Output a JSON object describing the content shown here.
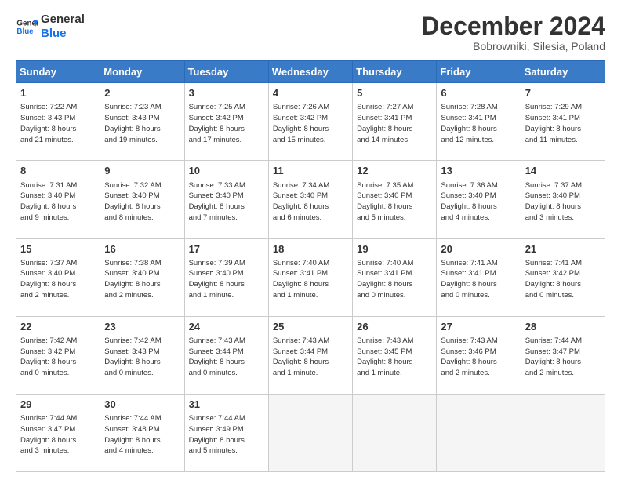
{
  "header": {
    "logo_general": "General",
    "logo_blue": "Blue",
    "month_title": "December 2024",
    "location": "Bobrowniki, Silesia, Poland"
  },
  "weekdays": [
    "Sunday",
    "Monday",
    "Tuesday",
    "Wednesday",
    "Thursday",
    "Friday",
    "Saturday"
  ],
  "weeks": [
    [
      {
        "day": "1",
        "lines": [
          "Sunrise: 7:22 AM",
          "Sunset: 3:43 PM",
          "Daylight: 8 hours",
          "and 21 minutes."
        ]
      },
      {
        "day": "2",
        "lines": [
          "Sunrise: 7:23 AM",
          "Sunset: 3:43 PM",
          "Daylight: 8 hours",
          "and 19 minutes."
        ]
      },
      {
        "day": "3",
        "lines": [
          "Sunrise: 7:25 AM",
          "Sunset: 3:42 PM",
          "Daylight: 8 hours",
          "and 17 minutes."
        ]
      },
      {
        "day": "4",
        "lines": [
          "Sunrise: 7:26 AM",
          "Sunset: 3:42 PM",
          "Daylight: 8 hours",
          "and 15 minutes."
        ]
      },
      {
        "day": "5",
        "lines": [
          "Sunrise: 7:27 AM",
          "Sunset: 3:41 PM",
          "Daylight: 8 hours",
          "and 14 minutes."
        ]
      },
      {
        "day": "6",
        "lines": [
          "Sunrise: 7:28 AM",
          "Sunset: 3:41 PM",
          "Daylight: 8 hours",
          "and 12 minutes."
        ]
      },
      {
        "day": "7",
        "lines": [
          "Sunrise: 7:29 AM",
          "Sunset: 3:41 PM",
          "Daylight: 8 hours",
          "and 11 minutes."
        ]
      }
    ],
    [
      {
        "day": "8",
        "lines": [
          "Sunrise: 7:31 AM",
          "Sunset: 3:40 PM",
          "Daylight: 8 hours",
          "and 9 minutes."
        ]
      },
      {
        "day": "9",
        "lines": [
          "Sunrise: 7:32 AM",
          "Sunset: 3:40 PM",
          "Daylight: 8 hours",
          "and 8 minutes."
        ]
      },
      {
        "day": "10",
        "lines": [
          "Sunrise: 7:33 AM",
          "Sunset: 3:40 PM",
          "Daylight: 8 hours",
          "and 7 minutes."
        ]
      },
      {
        "day": "11",
        "lines": [
          "Sunrise: 7:34 AM",
          "Sunset: 3:40 PM",
          "Daylight: 8 hours",
          "and 6 minutes."
        ]
      },
      {
        "day": "12",
        "lines": [
          "Sunrise: 7:35 AM",
          "Sunset: 3:40 PM",
          "Daylight: 8 hours",
          "and 5 minutes."
        ]
      },
      {
        "day": "13",
        "lines": [
          "Sunrise: 7:36 AM",
          "Sunset: 3:40 PM",
          "Daylight: 8 hours",
          "and 4 minutes."
        ]
      },
      {
        "day": "14",
        "lines": [
          "Sunrise: 7:37 AM",
          "Sunset: 3:40 PM",
          "Daylight: 8 hours",
          "and 3 minutes."
        ]
      }
    ],
    [
      {
        "day": "15",
        "lines": [
          "Sunrise: 7:37 AM",
          "Sunset: 3:40 PM",
          "Daylight: 8 hours",
          "and 2 minutes."
        ]
      },
      {
        "day": "16",
        "lines": [
          "Sunrise: 7:38 AM",
          "Sunset: 3:40 PM",
          "Daylight: 8 hours",
          "and 2 minutes."
        ]
      },
      {
        "day": "17",
        "lines": [
          "Sunrise: 7:39 AM",
          "Sunset: 3:40 PM",
          "Daylight: 8 hours",
          "and 1 minute."
        ]
      },
      {
        "day": "18",
        "lines": [
          "Sunrise: 7:40 AM",
          "Sunset: 3:41 PM",
          "Daylight: 8 hours",
          "and 1 minute."
        ]
      },
      {
        "day": "19",
        "lines": [
          "Sunrise: 7:40 AM",
          "Sunset: 3:41 PM",
          "Daylight: 8 hours",
          "and 0 minutes."
        ]
      },
      {
        "day": "20",
        "lines": [
          "Sunrise: 7:41 AM",
          "Sunset: 3:41 PM",
          "Daylight: 8 hours",
          "and 0 minutes."
        ]
      },
      {
        "day": "21",
        "lines": [
          "Sunrise: 7:41 AM",
          "Sunset: 3:42 PM",
          "Daylight: 8 hours",
          "and 0 minutes."
        ]
      }
    ],
    [
      {
        "day": "22",
        "lines": [
          "Sunrise: 7:42 AM",
          "Sunset: 3:42 PM",
          "Daylight: 8 hours",
          "and 0 minutes."
        ]
      },
      {
        "day": "23",
        "lines": [
          "Sunrise: 7:42 AM",
          "Sunset: 3:43 PM",
          "Daylight: 8 hours",
          "and 0 minutes."
        ]
      },
      {
        "day": "24",
        "lines": [
          "Sunrise: 7:43 AM",
          "Sunset: 3:44 PM",
          "Daylight: 8 hours",
          "and 0 minutes."
        ]
      },
      {
        "day": "25",
        "lines": [
          "Sunrise: 7:43 AM",
          "Sunset: 3:44 PM",
          "Daylight: 8 hours",
          "and 1 minute."
        ]
      },
      {
        "day": "26",
        "lines": [
          "Sunrise: 7:43 AM",
          "Sunset: 3:45 PM",
          "Daylight: 8 hours",
          "and 1 minute."
        ]
      },
      {
        "day": "27",
        "lines": [
          "Sunrise: 7:43 AM",
          "Sunset: 3:46 PM",
          "Daylight: 8 hours",
          "and 2 minutes."
        ]
      },
      {
        "day": "28",
        "lines": [
          "Sunrise: 7:44 AM",
          "Sunset: 3:47 PM",
          "Daylight: 8 hours",
          "and 2 minutes."
        ]
      }
    ],
    [
      {
        "day": "29",
        "lines": [
          "Sunrise: 7:44 AM",
          "Sunset: 3:47 PM",
          "Daylight: 8 hours",
          "and 3 minutes."
        ]
      },
      {
        "day": "30",
        "lines": [
          "Sunrise: 7:44 AM",
          "Sunset: 3:48 PM",
          "Daylight: 8 hours",
          "and 4 minutes."
        ]
      },
      {
        "day": "31",
        "lines": [
          "Sunrise: 7:44 AM",
          "Sunset: 3:49 PM",
          "Daylight: 8 hours",
          "and 5 minutes."
        ]
      },
      null,
      null,
      null,
      null
    ]
  ]
}
